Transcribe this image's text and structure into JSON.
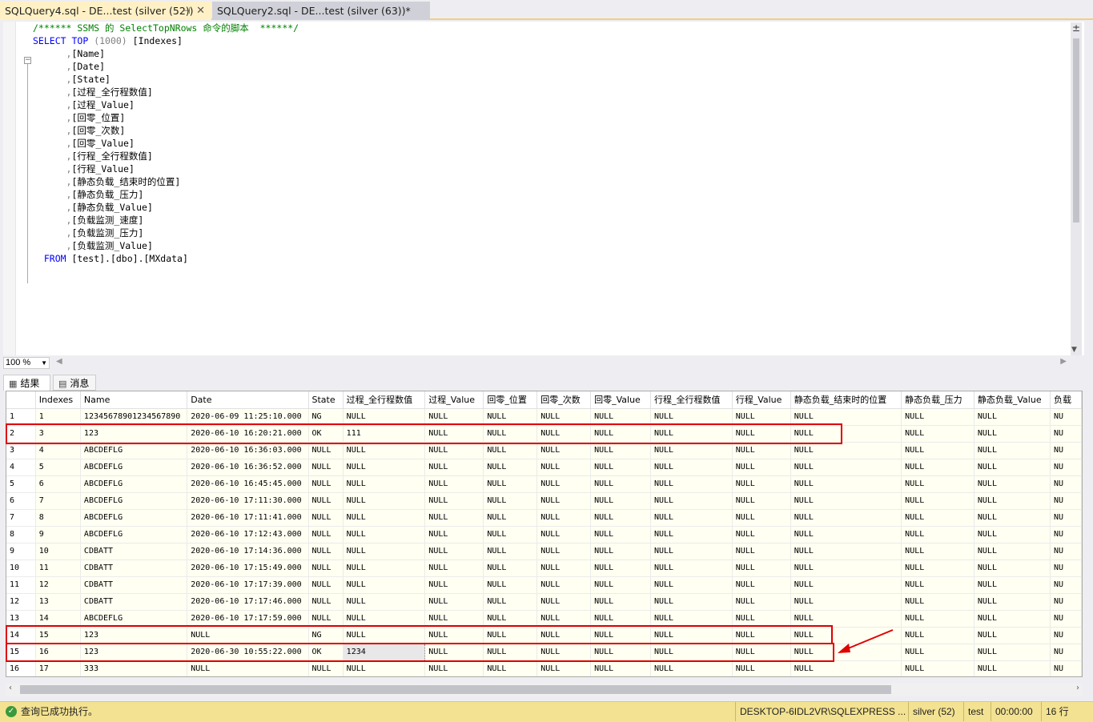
{
  "tabs": [
    {
      "label": "SQLQuery4.sql - DE...test (silver (52))",
      "pin": "⊣",
      "close": "✕"
    },
    {
      "label": "SQLQuery2.sql - DE...test (silver (63))*"
    }
  ],
  "editor": {
    "comment": "/****** SSMS 的 SelectTopNRows 命令的脚本  ******/",
    "select_kw": "SELECT",
    "top_kw": "TOP",
    "top_args": " (1000) ",
    "first_col": "[Indexes]",
    "columns": [
      "[Name]",
      "[Date]",
      "[State]",
      "[过程_全行程数值]",
      "[过程_Value]",
      "[回零_位置]",
      "[回零_次数]",
      "[回零_Value]",
      "[行程_全行程数值]",
      "[行程_Value]",
      "[静态负载_结束时的位置]",
      "[静态负载_压力]",
      "[静态负载_Value]",
      "[负载监测_速度]",
      "[负载监测_压力]",
      "[负载监测_Value]"
    ],
    "from_kw": "FROM",
    "from_target": "[test].[dbo].[MXdata]"
  },
  "zoom": {
    "value": "100 %"
  },
  "result_tabs": {
    "results": "结果",
    "messages": "消息"
  },
  "grid": {
    "headers": [
      "",
      "Indexes",
      "Name",
      "Date",
      "State",
      "过程_全行程数值",
      "过程_Value",
      "回零_位置",
      "回零_次数",
      "回零_Value",
      "行程_全行程数值",
      "行程_Value",
      "静态负载_结束时的位置",
      "静态负载_压力",
      "静态负载_Value",
      "负载"
    ],
    "rows": [
      [
        "1",
        "1",
        "12345678901234567890",
        "2020-06-09 11:25:10.000",
        "NG",
        "NULL",
        "NULL",
        "NULL",
        "NULL",
        "NULL",
        "NULL",
        "NULL",
        "NULL",
        "NULL",
        "NULL",
        "NU"
      ],
      [
        "2",
        "3",
        "123",
        "2020-06-10 16:20:21.000",
        "OK",
        "111",
        "NULL",
        "NULL",
        "NULL",
        "NULL",
        "NULL",
        "NULL",
        "NULL",
        "NULL",
        "NULL",
        "NU"
      ],
      [
        "3",
        "4",
        "ABCDEFLG",
        "2020-06-10 16:36:03.000",
        "NULL",
        "NULL",
        "NULL",
        "NULL",
        "NULL",
        "NULL",
        "NULL",
        "NULL",
        "NULL",
        "NULL",
        "NULL",
        "NU"
      ],
      [
        "4",
        "5",
        "ABCDEFLG",
        "2020-06-10 16:36:52.000",
        "NULL",
        "NULL",
        "NULL",
        "NULL",
        "NULL",
        "NULL",
        "NULL",
        "NULL",
        "NULL",
        "NULL",
        "NULL",
        "NU"
      ],
      [
        "5",
        "6",
        "ABCDEFLG",
        "2020-06-10 16:45:45.000",
        "NULL",
        "NULL",
        "NULL",
        "NULL",
        "NULL",
        "NULL",
        "NULL",
        "NULL",
        "NULL",
        "NULL",
        "NULL",
        "NU"
      ],
      [
        "6",
        "7",
        "ABCDEFLG",
        "2020-06-10 17:11:30.000",
        "NULL",
        "NULL",
        "NULL",
        "NULL",
        "NULL",
        "NULL",
        "NULL",
        "NULL",
        "NULL",
        "NULL",
        "NULL",
        "NU"
      ],
      [
        "7",
        "8",
        "ABCDEFLG",
        "2020-06-10 17:11:41.000",
        "NULL",
        "NULL",
        "NULL",
        "NULL",
        "NULL",
        "NULL",
        "NULL",
        "NULL",
        "NULL",
        "NULL",
        "NULL",
        "NU"
      ],
      [
        "8",
        "9",
        "ABCDEFLG",
        "2020-06-10 17:12:43.000",
        "NULL",
        "NULL",
        "NULL",
        "NULL",
        "NULL",
        "NULL",
        "NULL",
        "NULL",
        "NULL",
        "NULL",
        "NULL",
        "NU"
      ],
      [
        "9",
        "10",
        "CDBATT",
        "2020-06-10 17:14:36.000",
        "NULL",
        "NULL",
        "NULL",
        "NULL",
        "NULL",
        "NULL",
        "NULL",
        "NULL",
        "NULL",
        "NULL",
        "NULL",
        "NU"
      ],
      [
        "10",
        "11",
        "CDBATT",
        "2020-06-10 17:15:49.000",
        "NULL",
        "NULL",
        "NULL",
        "NULL",
        "NULL",
        "NULL",
        "NULL",
        "NULL",
        "NULL",
        "NULL",
        "NULL",
        "NU"
      ],
      [
        "11",
        "12",
        "CDBATT",
        "2020-06-10 17:17:39.000",
        "NULL",
        "NULL",
        "NULL",
        "NULL",
        "NULL",
        "NULL",
        "NULL",
        "NULL",
        "NULL",
        "NULL",
        "NULL",
        "NU"
      ],
      [
        "12",
        "13",
        "CDBATT",
        "2020-06-10 17:17:46.000",
        "NULL",
        "NULL",
        "NULL",
        "NULL",
        "NULL",
        "NULL",
        "NULL",
        "NULL",
        "NULL",
        "NULL",
        "NULL",
        "NU"
      ],
      [
        "13",
        "14",
        "ABCDEFLG",
        "2020-06-10 17:17:59.000",
        "NULL",
        "NULL",
        "NULL",
        "NULL",
        "NULL",
        "NULL",
        "NULL",
        "NULL",
        "NULL",
        "NULL",
        "NULL",
        "NU"
      ],
      [
        "14",
        "15",
        "123",
        "NULL",
        "NG",
        "NULL",
        "NULL",
        "NULL",
        "NULL",
        "NULL",
        "NULL",
        "NULL",
        "NULL",
        "NULL",
        "NULL",
        "NU"
      ],
      [
        "15",
        "16",
        "123",
        "2020-06-30 10:55:22.000",
        "OK",
        "1234",
        "NULL",
        "NULL",
        "NULL",
        "NULL",
        "NULL",
        "NULL",
        "NULL",
        "NULL",
        "NULL",
        "NU"
      ],
      [
        "16",
        "17",
        "333",
        "NULL",
        "NULL",
        "NULL",
        "NULL",
        "NULL",
        "NULL",
        "NULL",
        "NULL",
        "NULL",
        "NULL",
        "NULL",
        "NULL",
        "NU"
      ]
    ]
  },
  "status": {
    "message": "查询已成功执行。",
    "server": "DESKTOP-6IDL2VR\\SQLEXPRESS ...",
    "user": "silver (52)",
    "db": "test",
    "elapsed": "00:00:00",
    "rowcount": "16 行"
  },
  "colors": {
    "highlight_box": "#e00000",
    "status_bg": "#f3e291",
    "active_tab": "#fff1c5"
  }
}
